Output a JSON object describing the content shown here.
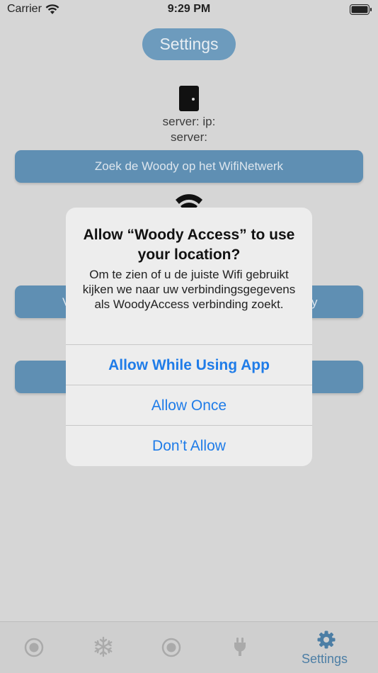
{
  "status_bar": {
    "carrier": "Carrier",
    "time": "9:29 PM"
  },
  "screen": {
    "title": "Settings",
    "server_ip": "server:  ip:",
    "server_label": "server:",
    "search_button": "Zoek de Woody op het WifiNetwerk",
    "button2_left_fragment": "V",
    "button2_right_fragment": "y"
  },
  "alert": {
    "title": "Allow “Woody Access” to use your location?",
    "message": "Om te zien of u de juiste Wifi gebruikt kijken we naar uw verbindingsgegevens als WoodyAccess verbinding zoekt.",
    "actions": {
      "allow_while_using": "Allow While Using App",
      "allow_once": "Allow Once",
      "dont_allow": "Don’t Allow"
    }
  },
  "tab_bar": {
    "settings_label": "Settings"
  },
  "colors": {
    "accent": "#5f8fb3",
    "alert_action": "#1f7ce8",
    "tab_active": "#4c7ea5"
  }
}
